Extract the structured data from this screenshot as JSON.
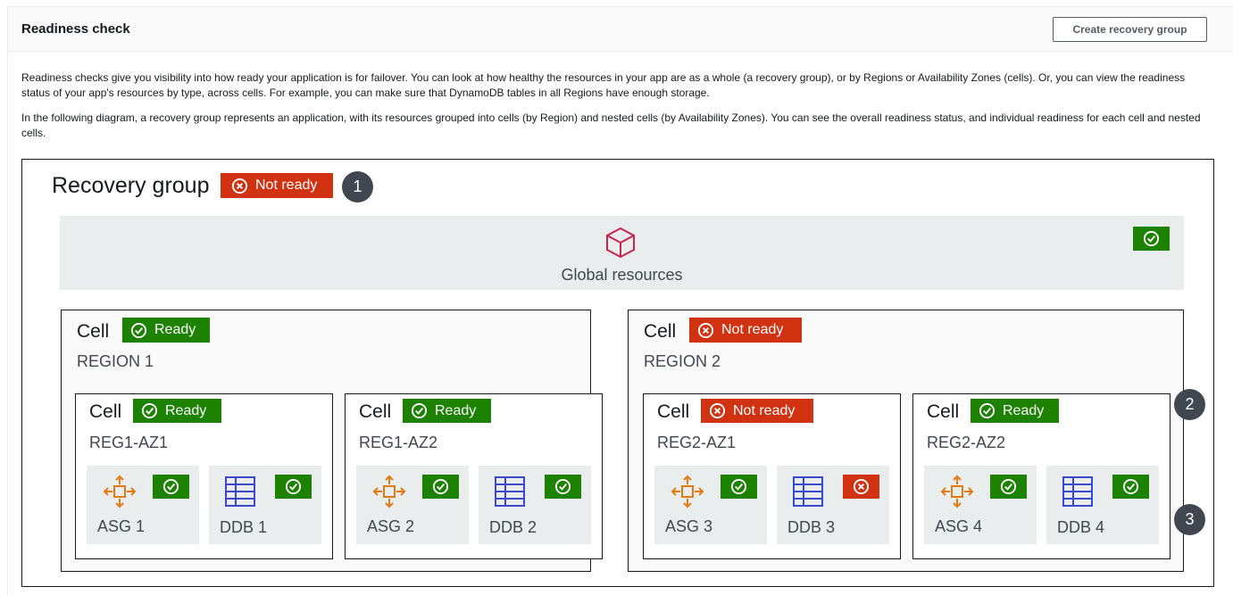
{
  "header": {
    "title": "Readiness check",
    "create_button": "Create recovery group"
  },
  "description": {
    "p1": "Readiness checks give you visibility into how ready your application is for failover. You can look at how healthy the resources in your app are as a whole (a recovery group), or by Regions or Availability Zones (cells). Or, you can view the readiness status of your app's resources by type, across cells. For example, you can make sure that DynamoDB tables in all Regions have enough storage.",
    "p2": "In the following diagram, a recovery group represents an application, with its resources grouped into cells (by Region) and nested cells (by Availability Zones). You can see the overall readiness status, and individual readiness for each cell and nested cells."
  },
  "diagram": {
    "recovery_group": {
      "title": "Recovery group",
      "status": "Not ready"
    },
    "global_resources": {
      "label": "Global resources"
    },
    "callouts": [
      "1",
      "2",
      "3"
    ],
    "cell_word": "Cell",
    "regions": [
      {
        "name": "REGION 1",
        "status": "Ready",
        "zones": [
          {
            "name": "REG1-AZ1",
            "status": "Ready",
            "resources": [
              {
                "label": "ASG 1",
                "icon": "auto-scaling-icon",
                "ok": true
              },
              {
                "label": "DDB 1",
                "icon": "dynamodb-table-icon",
                "ok": true
              }
            ]
          },
          {
            "name": "REG1-AZ2",
            "status": "Ready",
            "resources": [
              {
                "label": "ASG 2",
                "icon": "auto-scaling-icon",
                "ok": true
              },
              {
                "label": "DDB 2",
                "icon": "dynamodb-table-icon",
                "ok": true
              }
            ]
          }
        ]
      },
      {
        "name": "REGION 2",
        "status": "Not ready",
        "zones": [
          {
            "name": "REG2-AZ1",
            "status": "Not ready",
            "resources": [
              {
                "label": "ASG 3",
                "icon": "auto-scaling-icon",
                "ok": true
              },
              {
                "label": "DDB 3",
                "icon": "dynamodb-table-icon",
                "ok": false
              }
            ]
          },
          {
            "name": "REG2-AZ2",
            "status": "Ready",
            "resources": [
              {
                "label": "ASG 4",
                "icon": "auto-scaling-icon",
                "ok": true
              },
              {
                "label": "DDB 4",
                "icon": "dynamodb-table-icon",
                "ok": true
              }
            ]
          }
        ]
      }
    ]
  },
  "colors": {
    "ready": "#1d8102",
    "not_ready": "#d13212",
    "callout": "#414750",
    "asg_icon": "#e07a12",
    "ddb_icon": "#3b48cc",
    "cube_icon": "#c7254e"
  }
}
